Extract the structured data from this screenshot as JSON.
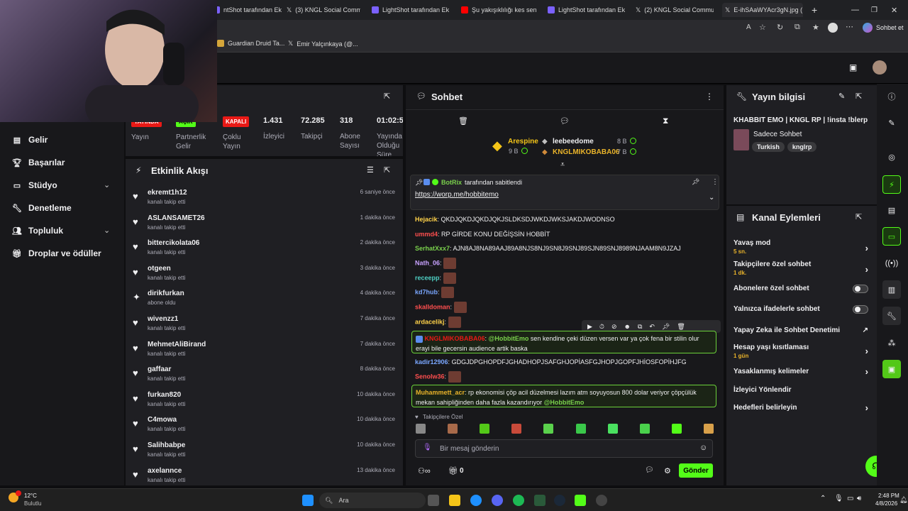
{
  "browser": {
    "tabs": [
      {
        "label": "ntShot tarafından Ek",
        "color": "#7b61ff"
      },
      {
        "label": "(3) KNGL Social Commu",
        "color": "#ffffff"
      },
      {
        "label": "LightShot tarafından Ek",
        "color": "#7b61ff"
      },
      {
        "label": "Şu yakışıklılığı kes sen",
        "color": "#ff0000"
      },
      {
        "label": "LightShot tarafından Ek",
        "color": "#7b61ff"
      },
      {
        "label": "(2) KNGL Social Commu",
        "color": "#ffffff"
      },
      {
        "label": "E-ihSAaWYAcr3gN.jpg (",
        "color": "#ffffff"
      }
    ],
    "copilot_label": "Sohbet et",
    "bookmarks": [
      "Guardian Druid Ta...",
      "Emir Yalçınkaya (@..."
    ]
  },
  "left_nav": {
    "items": [
      {
        "label": "Gelir",
        "icon": "wallet-icon"
      },
      {
        "label": "Başarılar",
        "icon": "trophy-icon"
      },
      {
        "label": "Stüdyo",
        "icon": "studio-icon"
      },
      {
        "label": "Denetleme",
        "icon": "wrench-icon"
      },
      {
        "label": "Topluluk",
        "icon": "users-icon"
      },
      {
        "label": "Droplar ve ödüller",
        "icon": "gift-icon"
      }
    ]
  },
  "stats": {
    "header_fragment": "eri",
    "items": [
      {
        "tag": "YAYINDA",
        "label": "Yayın"
      },
      {
        "tag": "AÇIK",
        "label": "Partnerlik Gelir"
      },
      {
        "tag": "KAPALI",
        "label": "Çoklu Yayın"
      },
      {
        "value": "1.431",
        "label": "İzleyici"
      },
      {
        "value": "72.285",
        "label": "Takipçi"
      },
      {
        "value": "318",
        "label": "Abone Sayısı"
      },
      {
        "value": "01:02:57",
        "label": "Yayında Olduğu Süre"
      }
    ]
  },
  "activity": {
    "title": "Etkinlik Akışı",
    "rows": [
      {
        "user": "ekremt1h12",
        "action": "kanalı takip etti",
        "time": "6 saniye önce",
        "icon": "heart-icon"
      },
      {
        "user": "ASLANSAMET26",
        "action": "kanalı takip etti",
        "time": "1 dakika önce",
        "icon": "heart-icon"
      },
      {
        "user": "bittercikolata06",
        "action": "kanalı takip etti",
        "time": "2 dakika önce",
        "icon": "heart-icon"
      },
      {
        "user": "otgeen",
        "action": "kanalı takip etti",
        "time": "3 dakika önce",
        "icon": "heart-icon"
      },
      {
        "user": "dirikfurkan",
        "action": "abone oldu",
        "time": "4 dakika önce",
        "icon": "star-icon"
      },
      {
        "user": "wivenzz1",
        "action": "kanalı takip etti",
        "time": "7 dakika önce",
        "icon": "heart-icon"
      },
      {
        "user": "MehmetAliBirand",
        "action": "kanalı takip etti",
        "time": "7 dakika önce",
        "icon": "heart-icon"
      },
      {
        "user": "gaffaar",
        "action": "kanalı takip etti",
        "time": "8 dakika önce",
        "icon": "heart-icon"
      },
      {
        "user": "furkan820",
        "action": "kanalı takip etti",
        "time": "10 dakika önce",
        "icon": "heart-icon"
      },
      {
        "user": "C4mowa",
        "action": "kanalı takip etti",
        "time": "10 dakika önce",
        "icon": "heart-icon"
      },
      {
        "user": "Salihbabpe",
        "action": "kanalı takip etti",
        "time": "10 dakika önce",
        "icon": "heart-icon"
      },
      {
        "user": "axelannce",
        "action": "kanalı takip etti",
        "time": "13 dakika önce",
        "icon": "heart-icon"
      }
    ]
  },
  "chat": {
    "title": "Sohbet",
    "leaderboard": [
      {
        "name": "Arespine",
        "amount": "9 B"
      },
      {
        "name": "leebeedome",
        "amount": "8 B"
      },
      {
        "name": "KNGLMIKOBABA06",
        "amount": "7 B"
      }
    ],
    "pinned": {
      "by": "BotRix",
      "by_suffix": "tarafından sabitlendi",
      "link": "https://worp.me/hobbitemo"
    },
    "messages": [
      {
        "user": "Hejacik",
        "color": "#ffd24a",
        "text": "QKDJQKDJQKDJQKJSLDKSDJWKDJWKSJAKDJWODNSO"
      },
      {
        "user": "ummd4",
        "color": "#ff4f4f",
        "text": "RP GİRDE KONU DEĞİŞSİN HOBBİT"
      },
      {
        "user": "SerhatXxx7",
        "color": "#7ad14c",
        "text": "AJN8AJ8NA89AAJ89A8NJS8NJ9SN8J9SNJ89SJN89SNJ8989NJAAM8N9JZAJ"
      },
      {
        "user": "Nath_06",
        "color": "#c8a2ff",
        "text": ""
      },
      {
        "user": "receepp",
        "color": "#4fd1c5",
        "text": ""
      },
      {
        "user": "kd7hub",
        "color": "#7aa7ff",
        "text": ""
      },
      {
        "user": "skalldoman",
        "color": "#ff4f4f",
        "text": ""
      },
      {
        "user": "ardacelikj",
        "color": "#ffd24a",
        "text": ""
      },
      {
        "user": "kadir12906",
        "color": "#7aa7ff",
        "text": "GDGJDPGHOPDFJGHADHOPJSAFGHJOPİASFGJHOPJGOPFJHİOSFOPİHJFG"
      },
      {
        "user": "Senolw36",
        "color": "#ff4f4f",
        "text": ""
      }
    ],
    "highlight1": {
      "user": "KNGLMIKOBABA06",
      "mention": "@HobbitEmo",
      "text": "sen kendine çeki düzen versen var ya çok fena bir stilin olur erayi bile gecersin audience artik baska"
    },
    "highlight2": {
      "user": "Muhammett_acr",
      "text": "rp ekonomisi çöp acil düzelmesi lazım atm soyuyosun 800 dolar veriyor çöpçülük mekan sahipliğinden daha fazla kazandırıyor",
      "mention": "@HobbitEmo"
    },
    "followers_only": "Takipçilere Özel",
    "input_placeholder": "Bir mesaj gönderin",
    "points": "0",
    "send_label": "Gönder"
  },
  "stream_info": {
    "title": "Yayın bilgisi",
    "stream_title": "KHABBIT EMO | KNGL RP | !insta !blerp",
    "category": "Sadece Sohbet",
    "tags": [
      "Turkish",
      "knglrp"
    ]
  },
  "channel_actions": {
    "title": "Kanal Eylemleri",
    "rows": [
      {
        "label": "Yavaş mod",
        "sub": "5 sn.",
        "control": "arrow"
      },
      {
        "label": "Takipçilere özel sohbet",
        "sub": "1 dk.",
        "control": "arrow"
      },
      {
        "label": "Abonelere özel sohbet",
        "sub": "",
        "control": "toggle"
      },
      {
        "label": "Yalnızca ifadelerle sohbet",
        "sub": "",
        "control": "toggle"
      },
      {
        "label": "Yapay Zeka ile Sohbet Denetimi",
        "sub": "",
        "control": "external"
      },
      {
        "label": "Hesap yaşı kısıtlaması",
        "sub": "1 gün",
        "control": "arrow"
      },
      {
        "label": "Yasaklanmış kelimeler",
        "sub": "",
        "control": "arrow"
      },
      {
        "label": "İzleyici Yönlendir",
        "sub": "",
        "control": "none"
      },
      {
        "label": "Hedefleri belirleyin",
        "sub": "",
        "control": "arrow"
      }
    ]
  },
  "taskbar": {
    "weather_temp": "12°C",
    "weather_desc": "Bulutlu",
    "search_label": "Ara",
    "time": "2:48 PM",
    "date": "4/8/2026"
  },
  "colors": {
    "accent": "#53fc18",
    "live_red": "#e91916",
    "bg": "#0e0e10",
    "panel": "#1f1f23"
  }
}
